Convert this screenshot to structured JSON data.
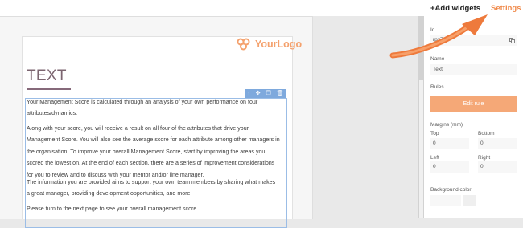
{
  "sidebar": {
    "add_widgets_label": "+Add widgets",
    "settings_label": "Settings",
    "id_label": "Id",
    "id_value": "rpx7fc",
    "name_label": "Name",
    "name_value": "Text",
    "rules_label": "Rules",
    "edit_rule_label": "Edit rule",
    "margins_label": "Margins (mm)",
    "top_label": "Top",
    "top_value": "0",
    "bottom_label": "Bottom",
    "bottom_value": "0",
    "left_label": "Left",
    "left_value": "0",
    "right_label": "Right",
    "right_value": "0",
    "background_color_label": "Background color"
  },
  "document": {
    "logo_text": "YourLogo",
    "title": "TEXT",
    "paragraphs": [
      "Your Management Score is calculated through an analysis of your own performance on four attributes/dynamics.",
      "Along with your score, you will receive a result on all four of the attributes that drive your Management Score. You will also see the average score for each attribute among other managers in the organisation. To improve your overall Management Score, start by improving the areas you scored the lowest on. At the end of each section, there are a series of improvement considerations for you to review and to discuss with your mentor and/or line manager.",
      "The information you are provided aims to support your own team members by sharing what makes a great manager, providing development opportunities, and more.",
      "Please turn to the next page to see your overall management score."
    ]
  },
  "colors": {
    "accent": "#f08a4b",
    "button": "#f5a877",
    "selection": "#7ea9dd",
    "title": "#7c6570"
  },
  "icons": [
    "arrow-up-icon",
    "move-icon",
    "copy-icon",
    "delete-icon",
    "copy-id-icon",
    "logo-icon",
    "annotation-arrow-icon"
  ]
}
